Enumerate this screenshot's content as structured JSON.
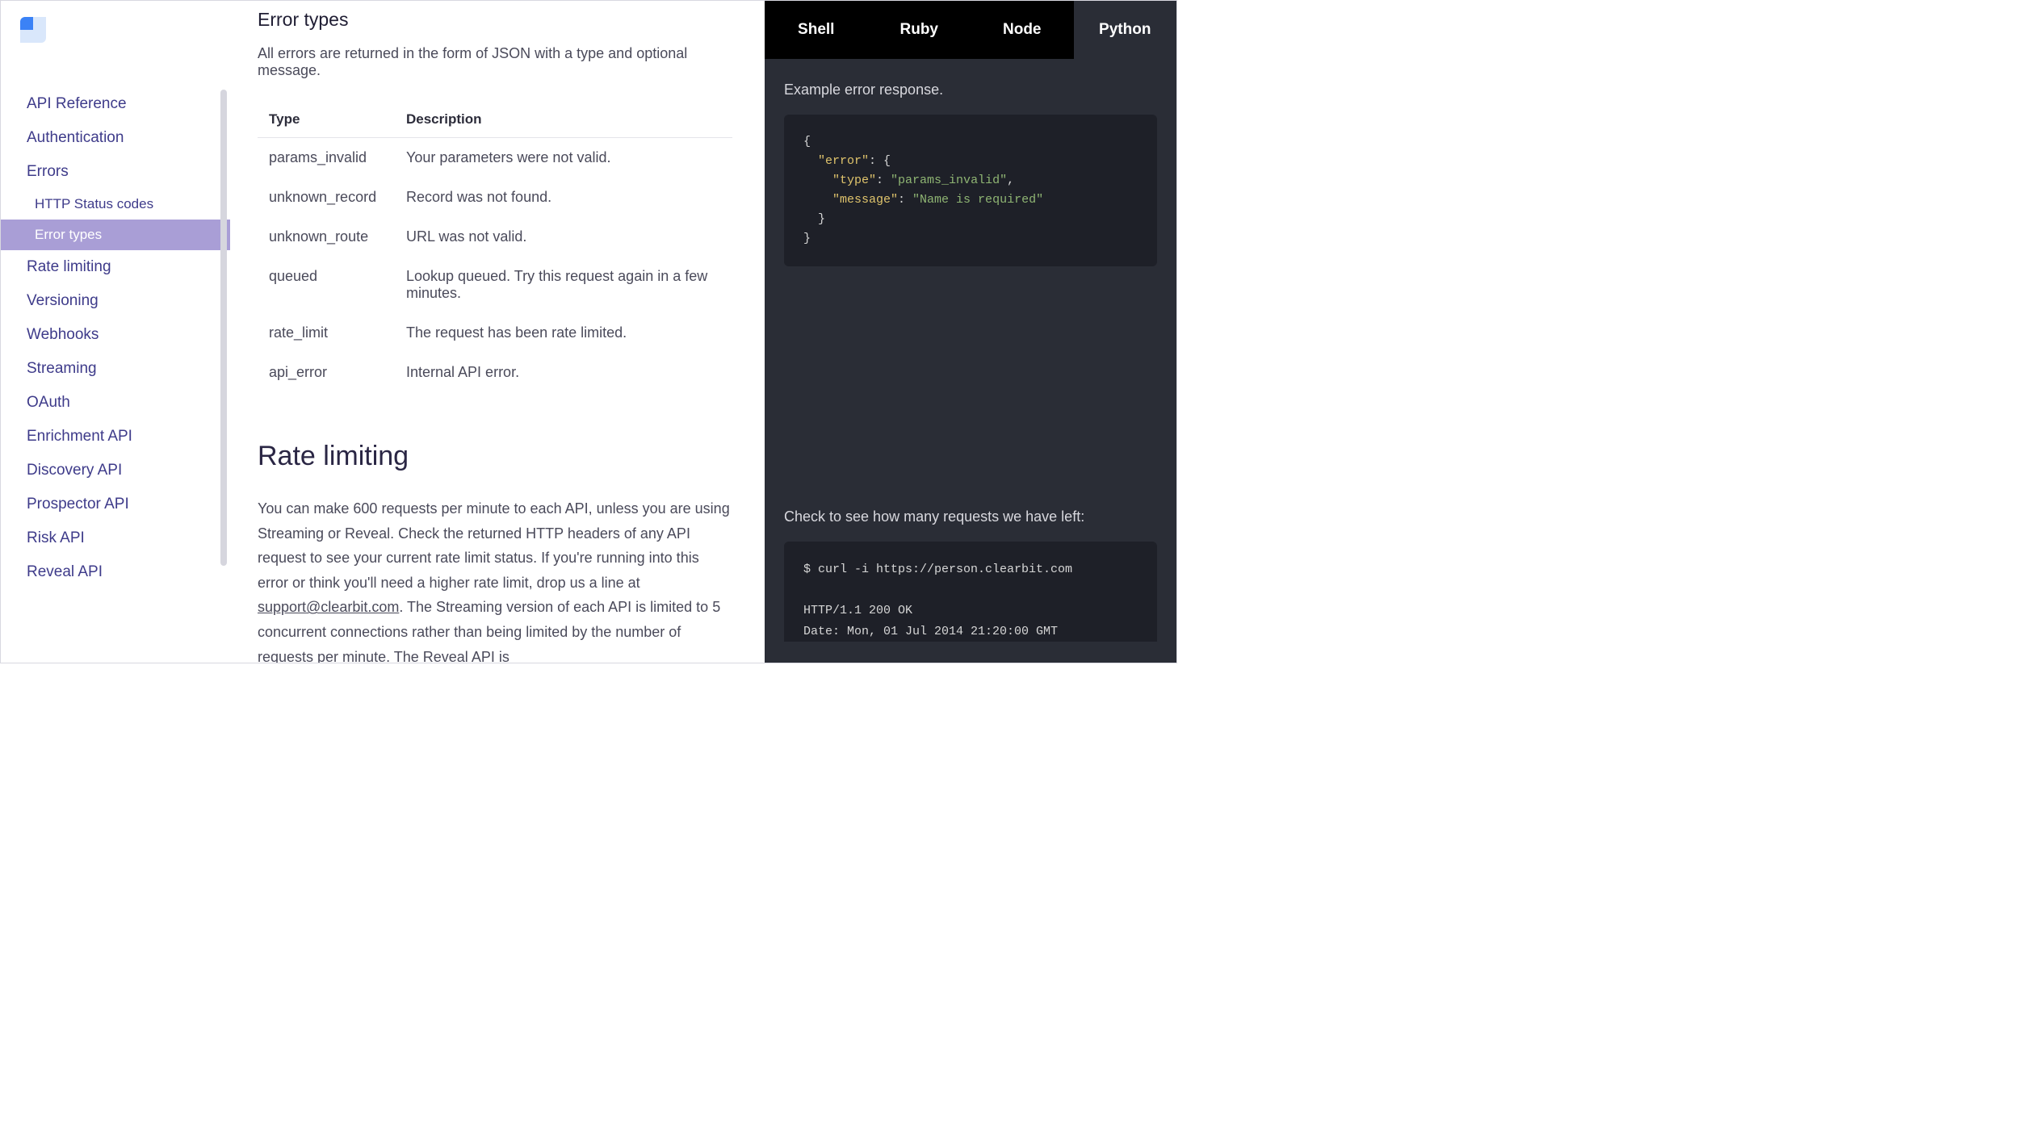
{
  "sidebar": {
    "items": [
      {
        "label": "API Reference"
      },
      {
        "label": "Authentication"
      },
      {
        "label": "Errors",
        "children": [
          {
            "label": "HTTP Status codes",
            "active": false
          },
          {
            "label": "Error types",
            "active": true
          }
        ]
      },
      {
        "label": "Rate limiting"
      },
      {
        "label": "Versioning"
      },
      {
        "label": "Webhooks"
      },
      {
        "label": "Streaming"
      },
      {
        "label": "OAuth"
      },
      {
        "label": "Enrichment API"
      },
      {
        "label": "Discovery API"
      },
      {
        "label": "Prospector API"
      },
      {
        "label": "Risk API"
      },
      {
        "label": "Reveal API"
      }
    ]
  },
  "main": {
    "error_types": {
      "title": "Error types",
      "intro": "All errors are returned in the form of JSON with a type and optional message.",
      "table_headers": {
        "type": "Type",
        "desc": "Description"
      },
      "rows": [
        {
          "type": "params_invalid",
          "desc": "Your parameters were not valid."
        },
        {
          "type": "unknown_record",
          "desc": "Record was not found."
        },
        {
          "type": "unknown_route",
          "desc": "URL was not valid."
        },
        {
          "type": "queued",
          "desc": "Lookup queued. Try this request again in a few minutes."
        },
        {
          "type": "rate_limit",
          "desc": "The request has been rate limited."
        },
        {
          "type": "api_error",
          "desc": "Internal API error."
        }
      ]
    },
    "rate_limiting": {
      "title": "Rate limiting",
      "body_before_link": "You can make 600 requests per minute to each API, unless you are using Streaming or Reveal. Check the returned HTTP headers of any API request to see your current rate limit status. If you're running into this error or think you'll need a higher rate limit, drop us a line at ",
      "link_text": "support@clearbit.com",
      "body_after_link": ". The Streaming version of each API is limited to 5 concurrent connections rather than being limited by the number of requests per minute. The Reveal API is"
    }
  },
  "code": {
    "tabs": [
      "Shell",
      "Ruby",
      "Node",
      "Python"
    ],
    "active_tab_index": 2,
    "example1_caption": "Example error response.",
    "example1_json": {
      "k_error": "\"error\"",
      "k_type": "\"type\"",
      "v_type": "\"params_invalid\"",
      "k_message": "\"message\"",
      "v_message": "\"Name is required\""
    },
    "example2_caption": "Check to see how many requests we have left:",
    "example2_lines": [
      "$ curl -i https://person.clearbit.com",
      "",
      "HTTP/1.1 200 OK",
      "Date: Mon, 01 Jul 2014 21:20:00 GMT"
    ]
  }
}
